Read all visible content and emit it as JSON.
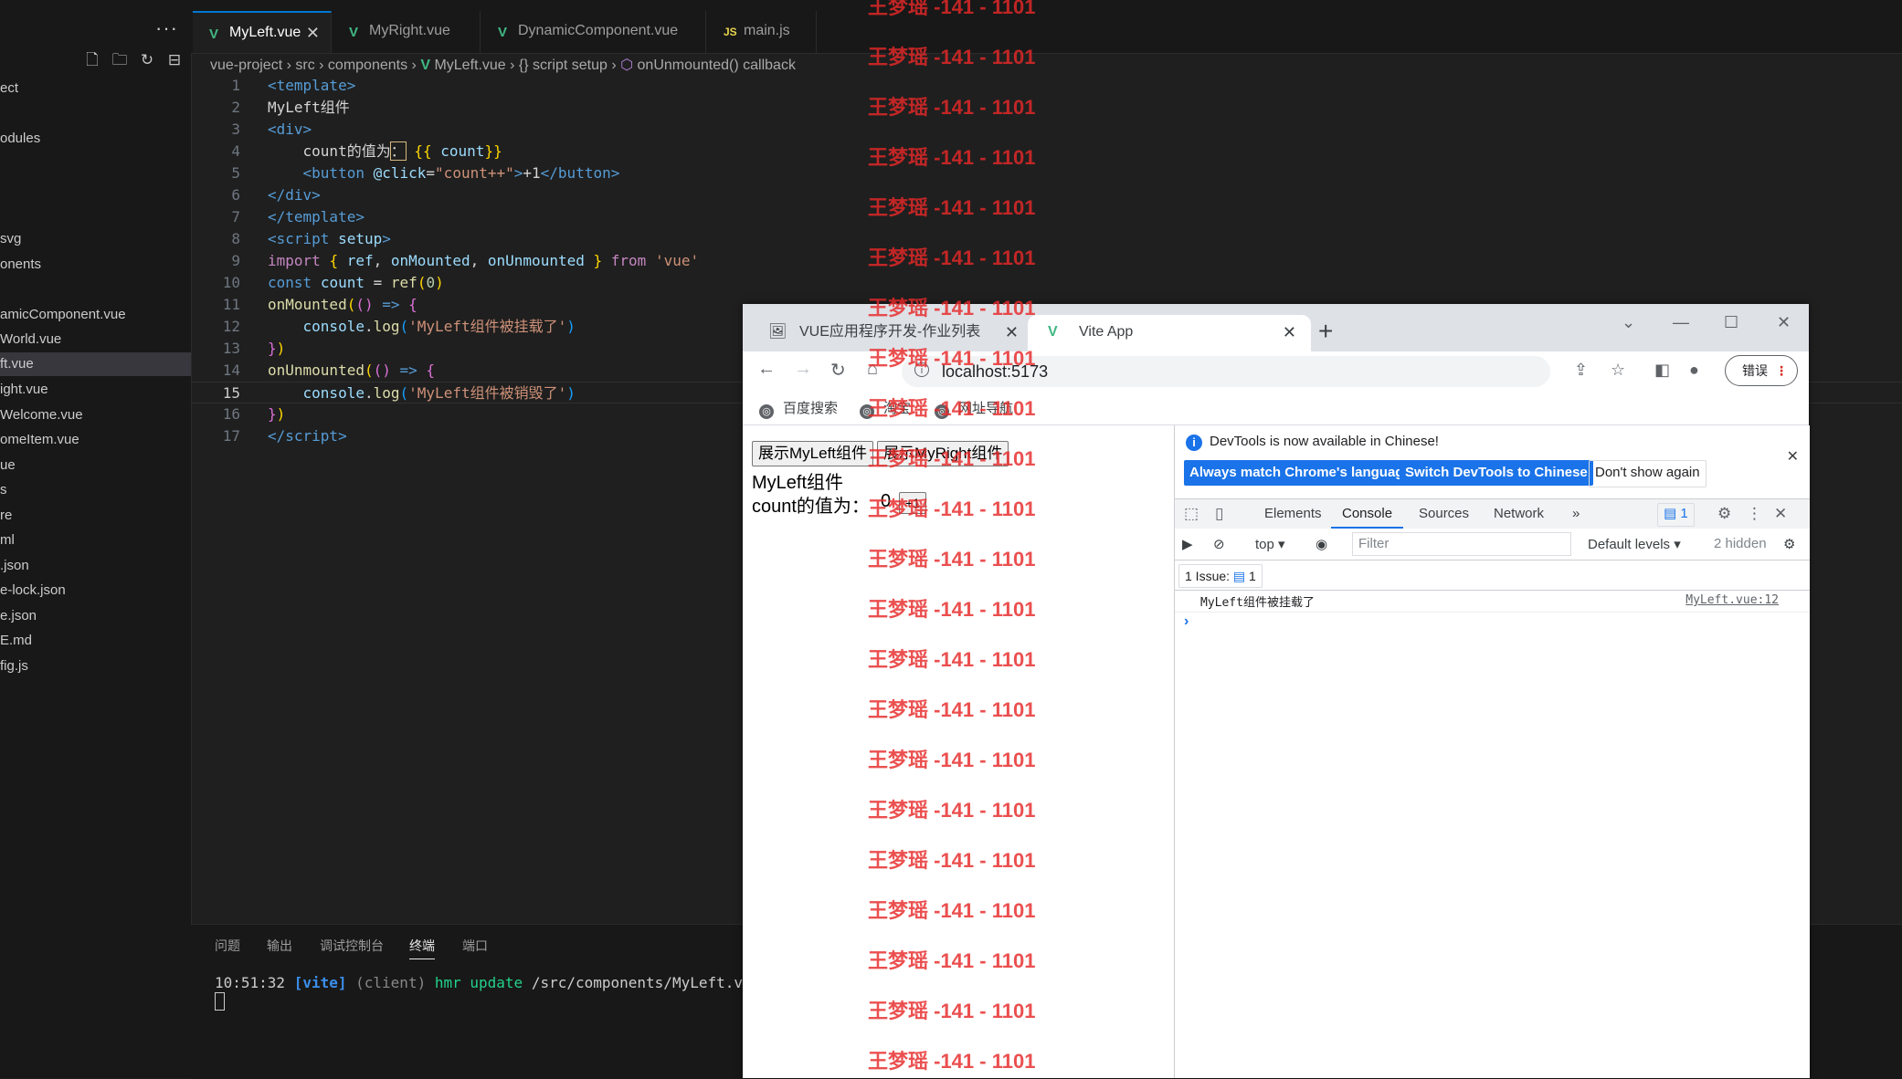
{
  "sidebar": {
    "more_label": "···",
    "items": [
      "ect",
      "odules",
      "svg",
      "onents",
      "amicComponent.vue",
      "World.vue",
      "ft.vue",
      "ight.vue",
      "Welcome.vue",
      "omeItem.vue",
      "ue",
      "s",
      "re",
      "ml",
      ".json",
      "e-lock.json",
      "e.json",
      "E.md",
      "fig.js"
    ]
  },
  "editor": {
    "tabs": [
      {
        "label": "MyLeft.vue",
        "icon": "vue-icon"
      },
      {
        "label": "MyRight.vue",
        "icon": "vue-icon"
      },
      {
        "label": "DynamicComponent.vue",
        "icon": "vue-icon"
      },
      {
        "label": "main.js",
        "icon": "js-icon",
        "icon_text": "JS"
      }
    ],
    "breadcrumb": [
      "vue-project",
      "src",
      "components",
      "MyLeft.vue",
      "{} script setup",
      "onUnmounted() callback"
    ],
    "current_line": 15
  },
  "panel": {
    "tabs": [
      "问题",
      "输出",
      "调试控制台",
      "终端",
      "端口"
    ],
    "active_tab": "终端",
    "terminal": {
      "time": "10:51:32",
      "tag": "[vite]",
      "client": "(client)",
      "msg": "hmr update",
      "path": "/src/components/MyLeft.vue"
    }
  },
  "browser": {
    "tabs": [
      {
        "title": "VUE应用程序开发-作业列表"
      },
      {
        "title": "Vite App"
      }
    ],
    "url": "localhost:5173",
    "profile_button": "错误",
    "bookmarks": [
      "百度搜索",
      "淘宝",
      "网址导航"
    ],
    "page": {
      "btn_left": "展示MyLeft组件",
      "btn_right": "展示MyRight组件",
      "heading": "MyLeft组件",
      "count_label": "count的值为：",
      "count_value": "0",
      "inc_button": "+1"
    }
  },
  "devtools": {
    "info": "DevTools is now available in Chinese!",
    "btn_match": "Always match Chrome's language",
    "btn_switch": "Switch DevTools to Chinese",
    "btn_dont": "Don't show again",
    "tabs": [
      "Elements",
      "Console",
      "Sources",
      "Network"
    ],
    "active_tab": "Console",
    "issues_badge": "1",
    "context": "top",
    "filter_placeholder": "Filter",
    "levels": "Default levels",
    "hidden": "2 hidden",
    "issues_label": "1 Issue:",
    "issues_count": "1",
    "log": {
      "message": "MyLeft组件被挂载了",
      "source": "MyLeft.vue:12"
    }
  },
  "watermark": "王梦瑶 -141 - 1101"
}
